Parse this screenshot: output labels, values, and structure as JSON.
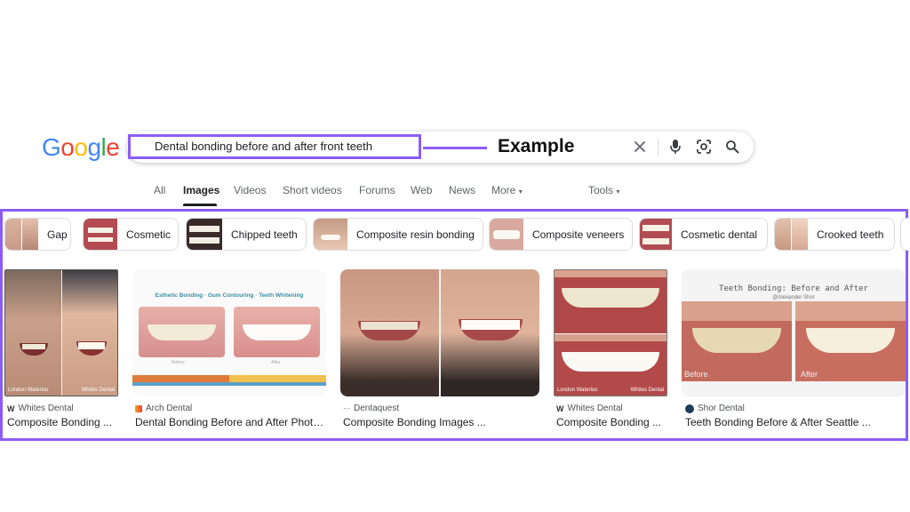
{
  "logo": {
    "letters": [
      {
        "ch": "G",
        "color": "#4285F4"
      },
      {
        "ch": "o",
        "color": "#EA4335"
      },
      {
        "ch": "o",
        "color": "#FBBC05"
      },
      {
        "ch": "g",
        "color": "#4285F4"
      },
      {
        "ch": "l",
        "color": "#34A853"
      },
      {
        "ch": "e",
        "color": "#EA4335"
      }
    ]
  },
  "search": {
    "query": "Dental bonding before and after front teeth",
    "icons": [
      "close-icon",
      "mic-icon",
      "lens-icon",
      "search-icon"
    ]
  },
  "callout": {
    "label": "Example"
  },
  "tabs": {
    "items": [
      "All",
      "Images",
      "Videos",
      "Short videos",
      "Forums",
      "Web",
      "News",
      "More"
    ],
    "active": "Images",
    "tools": "Tools"
  },
  "chips": [
    "Gap",
    "Cosmetic",
    "Chipped teeth",
    "Composite resin bonding",
    "Composite veneers",
    "Cosmetic dental",
    "Crooked teeth"
  ],
  "results": [
    {
      "source": "Whites Dental",
      "title": "Composite Bonding ...",
      "source_icon": "w-letter-icon"
    },
    {
      "source": "Arch Dental",
      "title": "Dental Bonding Before and After Photo...",
      "source_icon": "arch-logo-icon"
    },
    {
      "source": "Dentaquest",
      "title": "Composite Bonding Images ...",
      "source_icon": "dentaquest-logo-icon"
    },
    {
      "source": "Whites Dental",
      "title": "Composite Bonding ...",
      "source_icon": "w-letter-icon"
    },
    {
      "source": "Shor Dental",
      "title": "Teeth Bonding Before & After Seattle ...",
      "source_icon": "shor-logo-icon"
    }
  ],
  "images": {
    "card1": {
      "left_caption": "London Waterloo",
      "right_caption": "Whites Dental"
    },
    "card2": {
      "heading": "Esthetic Bonding · Gum Contouring · Teeth Whitening",
      "before": "Before",
      "after": "After"
    },
    "card4": {
      "left_caption": "London Waterloo",
      "right_caption": "Whites Dental"
    },
    "card5": {
      "heading": "Teeth Bonding: Before and After",
      "subheading": "@Alexander Shor",
      "before": "Before",
      "after": "After"
    }
  },
  "colors": {
    "accent": "#8b5cf6",
    "text": "#202124",
    "muted": "#5f6368"
  }
}
